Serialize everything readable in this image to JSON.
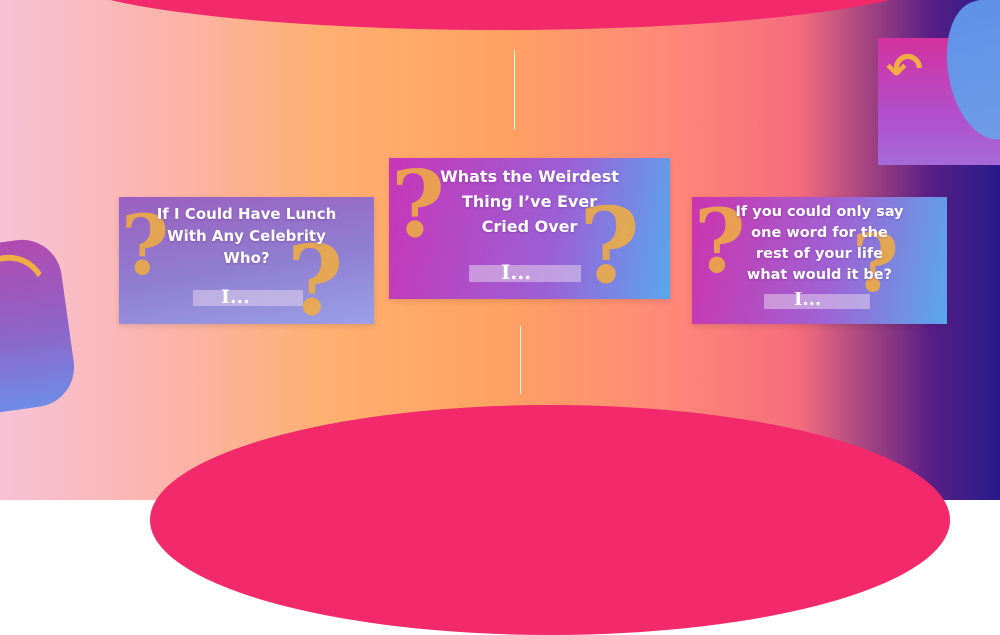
{
  "cards": [
    {
      "question": [
        "If I Could Have Lunch",
        "With Any Celebrity",
        "Who?"
      ],
      "answer": "I..."
    },
    {
      "question": [
        "Whats the Weirdest",
        "Thing I’ve Ever",
        "Cried Over"
      ],
      "answer": "I..."
    },
    {
      "question": [
        "If you could only say",
        "one word for the",
        "rest of your life",
        "what would it be?"
      ],
      "answer": "I..."
    }
  ],
  "decoration": {
    "icon": "question-mark",
    "colors": {
      "question_mark": "#f0ad42",
      "blob": "#f2296b",
      "text": "#ffffff"
    }
  }
}
